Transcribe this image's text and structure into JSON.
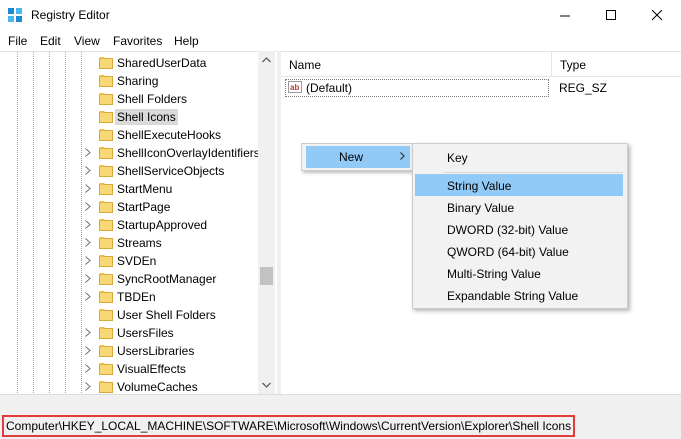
{
  "window": {
    "title": "Registry Editor",
    "controls": {
      "minimize": "minimize-icon",
      "maximize": "maximize-icon",
      "close": "close-icon"
    }
  },
  "menubar": [
    "File",
    "Edit",
    "View",
    "Favorites",
    "Help"
  ],
  "tree": {
    "items": [
      {
        "label": "SharedUserData",
        "expandable": false,
        "selected": false
      },
      {
        "label": "Sharing",
        "expandable": false,
        "selected": false
      },
      {
        "label": "Shell Folders",
        "expandable": false,
        "selected": false
      },
      {
        "label": "Shell Icons",
        "expandable": false,
        "selected": true
      },
      {
        "label": "ShellExecuteHooks",
        "expandable": false,
        "selected": false
      },
      {
        "label": "ShellIconOverlayIdentifiers",
        "expandable": true,
        "selected": false
      },
      {
        "label": "ShellServiceObjects",
        "expandable": true,
        "selected": false
      },
      {
        "label": "StartMenu",
        "expandable": true,
        "selected": false
      },
      {
        "label": "StartPage",
        "expandable": true,
        "selected": false
      },
      {
        "label": "StartupApproved",
        "expandable": true,
        "selected": false
      },
      {
        "label": "Streams",
        "expandable": true,
        "selected": false
      },
      {
        "label": "SVDEn",
        "expandable": true,
        "selected": false
      },
      {
        "label": "SyncRootManager",
        "expandable": true,
        "selected": false
      },
      {
        "label": "TBDEn",
        "expandable": true,
        "selected": false
      },
      {
        "label": "User Shell Folders",
        "expandable": false,
        "selected": false
      },
      {
        "label": "UsersFiles",
        "expandable": true,
        "selected": false
      },
      {
        "label": "UsersLibraries",
        "expandable": true,
        "selected": false
      },
      {
        "label": "VisualEffects",
        "expandable": true,
        "selected": false
      },
      {
        "label": "VolumeCaches",
        "expandable": true,
        "selected": false
      }
    ]
  },
  "list": {
    "columns": {
      "name": "Name",
      "type": "Type"
    },
    "rows": [
      {
        "name": "(Default)",
        "type": "REG_SZ",
        "icon": "ab-string-icon"
      }
    ]
  },
  "context_menu": {
    "new_label": "New",
    "submenu": {
      "key_label": "Key",
      "items": [
        "String Value",
        "Binary Value",
        "DWORD (32-bit) Value",
        "QWORD (64-bit) Value",
        "Multi-String Value",
        "Expandable String Value"
      ],
      "highlighted": "String Value"
    }
  },
  "status": {
    "path": "Computer\\HKEY_LOCAL_MACHINE\\SOFTWARE\\Microsoft\\Windows\\CurrentVersion\\Explorer\\Shell Icons"
  },
  "colors": {
    "highlight": "#91c9f7",
    "status_outline": "#e23b3b",
    "selection_gray": "#d9d9d9",
    "folder": "#f8d775"
  }
}
